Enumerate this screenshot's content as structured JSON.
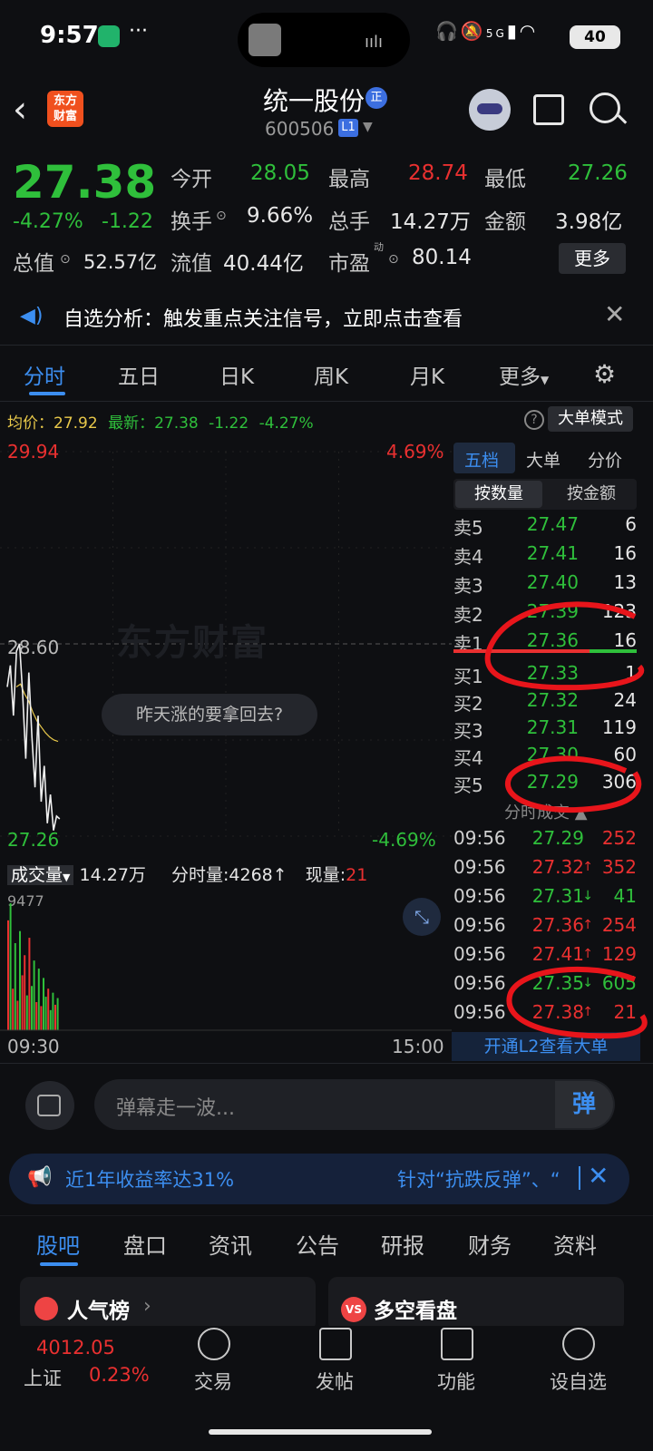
{
  "status": {
    "time": "9:57",
    "dots": "···",
    "battery": "40",
    "network": "5G"
  },
  "header": {
    "logo_text": "东方\n财富",
    "title": "统一股份",
    "badge": "正",
    "code": "600506",
    "level": "L1"
  },
  "quote": {
    "price": "27.38",
    "change_pct": "-4.27%",
    "change": "-1.22",
    "open_label": "今开",
    "open": "28.05",
    "high_label": "最高",
    "high": "28.74",
    "low_label": "最低",
    "low": "27.26",
    "turnover_label": "换手",
    "turnover": "9.66%",
    "volume_label": "总手",
    "volume": "14.27万",
    "amount_label": "金额",
    "amount": "3.98亿",
    "mktcap_label": "总值",
    "mktcap": "52.57亿",
    "float_label": "流值",
    "float": "40.44亿",
    "pe_label": "市盈",
    "pe_sup": "动",
    "pe": "80.14",
    "more": "更多"
  },
  "notice": {
    "text": "自选分析：触发重点关注信号，立即点击查看"
  },
  "tabs": [
    "分时",
    "五日",
    "日K",
    "周K",
    "月K",
    "更多"
  ],
  "chart": {
    "avg_label": "均价：27.92",
    "latest_label": "最新：27.38",
    "latest_chg": "-1.22",
    "latest_pct": "-4.27%",
    "big_order_mode": "大单模式",
    "y_max": "29.94",
    "pct_max": "4.69%",
    "y_mid": "28.60",
    "y_min": "27.26",
    "pct_min": "-4.69%",
    "watermark": "东方财富",
    "bubble": "昨天涨的要拿回去?",
    "vol_label": "成交量",
    "vol_total": "14.27万",
    "tick_vol_label": "分时量:4268",
    "cur_label": "现量:",
    "cur_val": "21",
    "vol_max": "9477",
    "x_start": "09:30",
    "x_end": "15:00"
  },
  "chart_data": {
    "type": "line",
    "x_range": [
      "09:30",
      "15:00"
    ],
    "ylim": [
      27.26,
      29.94
    ],
    "series": [
      {
        "name": "最新",
        "values": [
          28.3,
          28.45,
          28.1,
          28.55,
          28.6,
          28.25,
          27.8,
          28.4,
          27.95,
          27.6,
          28.1,
          27.5,
          27.75,
          27.35,
          27.55,
          27.3,
          27.4,
          27.38
        ]
      },
      {
        "name": "均价",
        "values": [
          28.3,
          28.32,
          28.25,
          28.2,
          28.12,
          28.06,
          28.02,
          27.98,
          27.95,
          27.93,
          27.92
        ]
      }
    ],
    "volume": [
      8200,
      9477,
      3100,
      6500,
      2200,
      7400,
      4100,
      5600,
      2600,
      6900,
      3300,
      5200,
      2100,
      4600,
      1800,
      3900,
      2500,
      3100,
      1500,
      2800,
      1900,
      2400
    ],
    "volume_colors": [
      "r",
      "g",
      "r",
      "g",
      "r",
      "g",
      "r",
      "r",
      "g",
      "r",
      "g",
      "g",
      "r",
      "g",
      "r",
      "g",
      "g",
      "r",
      "g",
      "g",
      "r",
      "g"
    ]
  },
  "orderbook": {
    "tabs": [
      "五档",
      "大单",
      "分价"
    ],
    "modes": [
      "按数量",
      "按金额"
    ],
    "asks": [
      {
        "label": "卖5",
        "price": "27.47",
        "qty": "6"
      },
      {
        "label": "卖4",
        "price": "27.41",
        "qty": "16"
      },
      {
        "label": "卖3",
        "price": "27.40",
        "qty": "13"
      },
      {
        "label": "卖2",
        "price": "27.39",
        "qty": "123"
      },
      {
        "label": "卖1",
        "price": "27.36",
        "qty": "16"
      }
    ],
    "bids": [
      {
        "label": "买1",
        "price": "27.33",
        "qty": "1"
      },
      {
        "label": "买2",
        "price": "27.32",
        "qty": "24"
      },
      {
        "label": "买3",
        "price": "27.31",
        "qty": "119"
      },
      {
        "label": "买4",
        "price": "27.30",
        "qty": "60"
      },
      {
        "label": "买5",
        "price": "27.29",
        "qty": "306"
      }
    ],
    "ticks_header": "分时成交",
    "ticks": [
      {
        "time": "09:56",
        "price": "27.29",
        "dir": "",
        "qty": "252"
      },
      {
        "time": "09:56",
        "price": "27.32",
        "dir": "↑",
        "qty": "352"
      },
      {
        "time": "09:56",
        "price": "27.31",
        "dir": "↓",
        "qty": "41"
      },
      {
        "time": "09:56",
        "price": "27.36",
        "dir": "↑",
        "qty": "254"
      },
      {
        "time": "09:56",
        "price": "27.41",
        "dir": "↑",
        "qty": "129"
      },
      {
        "time": "09:56",
        "price": "27.35",
        "dir": "↓",
        "qty": "605"
      },
      {
        "time": "09:56",
        "price": "27.38",
        "dir": "↑",
        "qty": "21"
      }
    ],
    "l2_btn": "开通L2查看大单"
  },
  "danmu": {
    "placeholder": "弹幕走一波...",
    "btn": "弹"
  },
  "ad": {
    "left": "近1年收益率达31%",
    "right": "针对“抗跌反弹”、“"
  },
  "bottom_tabs": [
    "股吧",
    "盘口",
    "资讯",
    "公告",
    "研报",
    "财务",
    "资料"
  ],
  "cards": {
    "hot": "人气榜",
    "vs": "多空看盘",
    "vs_icon": "VS"
  },
  "nav": {
    "index_value": "4012.05",
    "index_name": "上证",
    "index_pct": "0.23%",
    "items": [
      "交易",
      "发帖",
      "功能",
      "设自选"
    ]
  }
}
